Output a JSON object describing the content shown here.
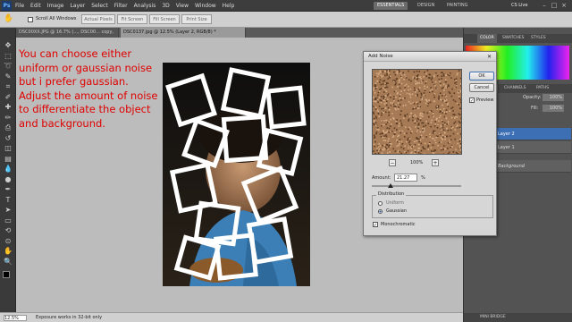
{
  "menubar": {
    "logo": "Ps",
    "items": [
      "File",
      "Edit",
      "Image",
      "Layer",
      "Select",
      "Filter",
      "Analysis",
      "3D",
      "View",
      "Window",
      "Help"
    ],
    "workspaces": [
      "ESSENTIALS",
      "DESIGN",
      "PAINTING"
    ],
    "cs_live": "CS Live"
  },
  "options": {
    "scroll_all": "Scroll All Windows",
    "buttons": [
      "Actual Pixels",
      "Fit Screen",
      "Fill Screen",
      "Print Size"
    ]
  },
  "doc_tabs": [
    "DSC00XX.JPG @ 16.7% (..., DSC00... copy, RGB/8)",
    "DSC0137.jpg @ 12.5% (Layer 2, RGB/8) *"
  ],
  "annotation": "You can choose either uniform or gaussian noise but i prefer gaussian. Adjust the amount of noise to differentiate the object and background.",
  "status": {
    "zoom": "12.5%",
    "message": "Exposure works in 32-bit only"
  },
  "panels": {
    "tabs_top": [
      "COLOR",
      "SWATCHES",
      "STYLES"
    ],
    "tabs_layers": [
      "LAYERS",
      "CHANNELS",
      "PATHS"
    ],
    "opacity_label": "Opacity:",
    "opacity_value": "100%",
    "fill_label": "Fill:",
    "fill_value": "100%",
    "layers": [
      "Layer 2",
      "Layer 1",
      "Background"
    ],
    "bottom_tab": "MINI BRIDGE"
  },
  "dialog": {
    "title": "Add Noise",
    "ok": "OK",
    "cancel": "Cancel",
    "preview_label": "Preview",
    "preview_checked": true,
    "zoom": "100%",
    "zoom_out": "−",
    "zoom_in": "+",
    "amount_label": "Amount:",
    "amount_value": "21.27",
    "amount_unit": "%",
    "amount_fraction": 0.2127,
    "distribution_label": "Distribution",
    "uniform_label": "Uniform",
    "gaussian_label": "Gaussian",
    "selected_distribution": "Gaussian",
    "monochromatic_label": "Monochromatic",
    "monochromatic_checked": true
  },
  "colors": {
    "annotation": "#e00000",
    "accent_blue": "#3d6fb5"
  }
}
